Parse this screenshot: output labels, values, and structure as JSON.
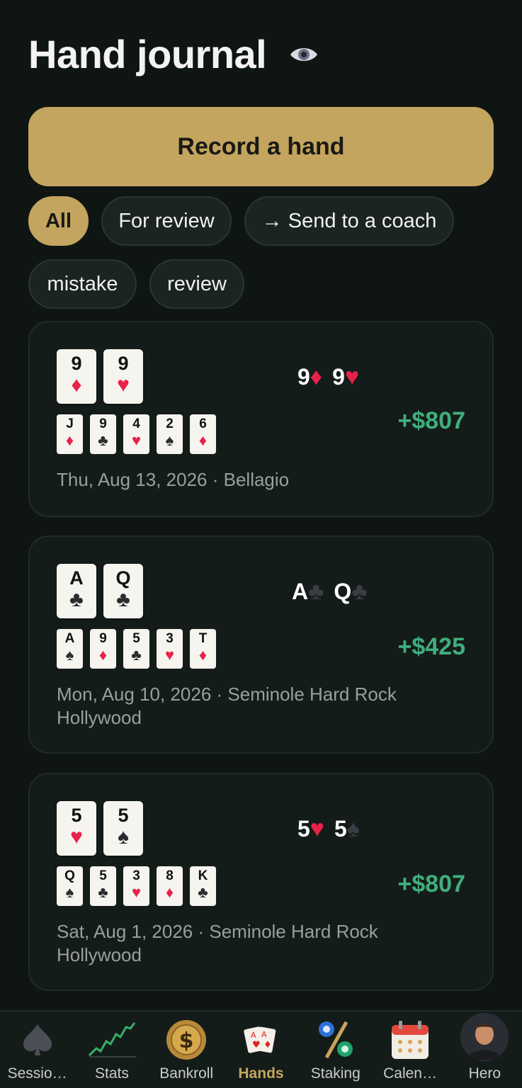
{
  "header": {
    "title": "Hand journal",
    "eye_icon": "eye-icon"
  },
  "record_button": {
    "label": "Record a hand"
  },
  "filters": [
    {
      "label": "All",
      "active": true
    },
    {
      "label": "For review",
      "active": false
    },
    {
      "label": "→ Send to a coach",
      "active": false
    },
    {
      "label": "mistake",
      "active": false
    },
    {
      "label": "review",
      "active": false
    }
  ],
  "hands": [
    {
      "hole": [
        {
          "rank": "9",
          "suit": "♦"
        },
        {
          "rank": "9",
          "suit": "♥"
        }
      ],
      "board": [
        {
          "rank": "J",
          "suit": "♦"
        },
        {
          "rank": "9",
          "suit": "♣"
        },
        {
          "rank": "4",
          "suit": "♥"
        },
        {
          "rank": "2",
          "suit": "♠"
        },
        {
          "rank": "6",
          "suit": "♦"
        }
      ],
      "hand_text": [
        "9",
        "♦",
        "9",
        "♥"
      ],
      "profit": "+$807",
      "meta": "Thu, Aug 13, 2026 · Bellagio"
    },
    {
      "hole": [
        {
          "rank": "A",
          "suit": "♣"
        },
        {
          "rank": "Q",
          "suit": "♣"
        }
      ],
      "board": [
        {
          "rank": "A",
          "suit": "♠"
        },
        {
          "rank": "9",
          "suit": "♦"
        },
        {
          "rank": "5",
          "suit": "♣"
        },
        {
          "rank": "3",
          "suit": "♥"
        },
        {
          "rank": "T",
          "suit": "♦"
        }
      ],
      "hand_text": [
        "A",
        "♣",
        "Q",
        "♣"
      ],
      "profit": "+$425",
      "meta": "Mon, Aug 10, 2026 · Seminole Hard Rock Hollywood"
    },
    {
      "hole": [
        {
          "rank": "5",
          "suit": "♥"
        },
        {
          "rank": "5",
          "suit": "♠"
        }
      ],
      "board": [
        {
          "rank": "Q",
          "suit": "♠"
        },
        {
          "rank": "5",
          "suit": "♣"
        },
        {
          "rank": "3",
          "suit": "♥"
        },
        {
          "rank": "8",
          "suit": "♦"
        },
        {
          "rank": "K",
          "suit": "♣"
        }
      ],
      "hand_text": [
        "5",
        "♥",
        "5",
        "♠"
      ],
      "profit": "+$807",
      "meta": "Sat, Aug 1, 2026 · Seminole Hard Rock Hollywood"
    }
  ],
  "nav": [
    {
      "label": "Sessio…",
      "icon": "spade-icon",
      "active": false
    },
    {
      "label": "Stats",
      "icon": "chart-line-icon",
      "active": false
    },
    {
      "label": "Bankroll",
      "icon": "dollar-coin-icon",
      "active": false
    },
    {
      "label": "Hands",
      "icon": "playing-cards-icon",
      "active": true
    },
    {
      "label": "Staking",
      "icon": "percent-chips-icon",
      "active": false
    },
    {
      "label": "Calen…",
      "icon": "calendar-icon",
      "active": false
    },
    {
      "label": "Hero",
      "icon": "avatar",
      "active": false
    }
  ],
  "colors": {
    "accent": "#c4a55f",
    "profit": "#3fae7d",
    "background": "#0f1513",
    "card_bg": "#141c19",
    "red_suit": "#e8224a"
  }
}
